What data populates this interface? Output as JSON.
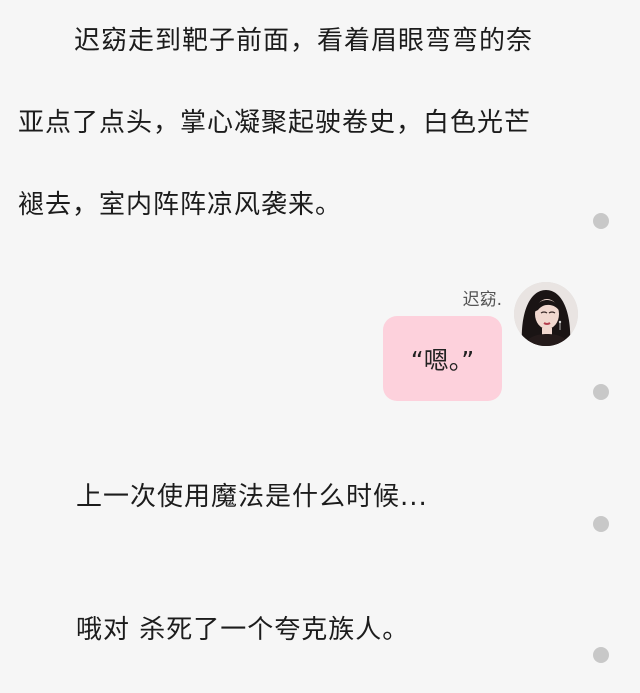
{
  "narration": {
    "line1": "迟窈走到靶子前面，看着眉眼弯弯的奈",
    "line2": "亚点了点头，掌心凝聚起驶卷史，白色光芒",
    "line3": "褪去，室内阵阵凉风袭来。"
  },
  "message": {
    "sender_name": "迟窈.",
    "text": "“嗯。”"
  },
  "lines": {
    "line4": "上一次使用魔法是什么时候...",
    "line5": "哦对 杀死了一个夸克族人。"
  },
  "colors": {
    "background": "#f6f6f6",
    "bubble": "#fdd1dc",
    "dot": "#c8c8c8",
    "text": "#1c1c1c"
  }
}
